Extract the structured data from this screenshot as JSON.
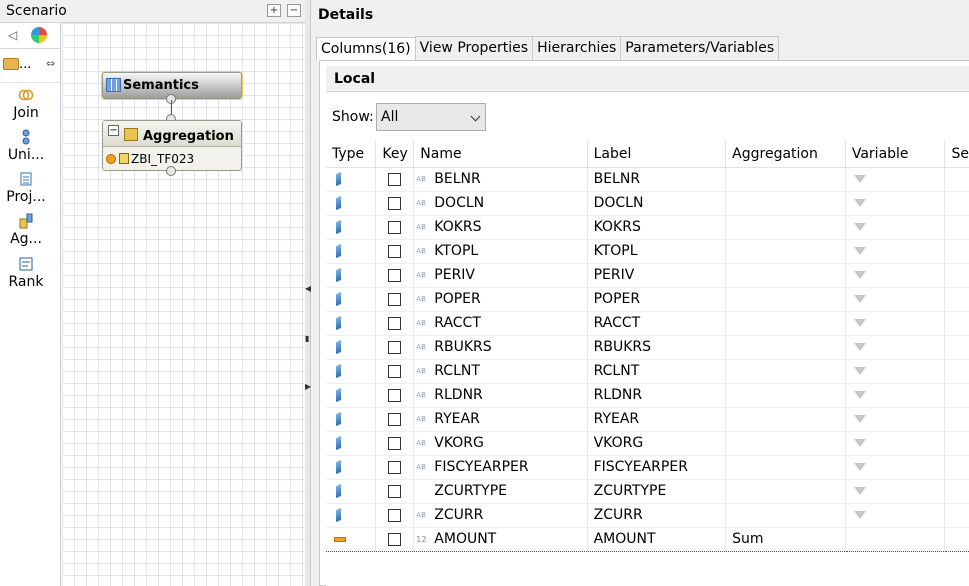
{
  "scenario": {
    "title": "Scenario",
    "palette_drawer_label": "...",
    "palette": [
      {
        "icon": "join-icon",
        "label": "Join"
      },
      {
        "icon": "union-icon",
        "label": "Uni..."
      },
      {
        "icon": "projection-icon",
        "label": "Proj..."
      },
      {
        "icon": "aggregation-icon",
        "label": "Ag..."
      },
      {
        "icon": "rank-icon",
        "label": "Rank"
      }
    ],
    "nodes": {
      "semantics": "Semantics",
      "aggregation": "Aggregation",
      "aggregation_source": "ZBI_TF023"
    }
  },
  "details": {
    "title": "Details",
    "tabs": [
      "Columns(16)",
      "View Properties",
      "Hierarchies",
      "Parameters/Variables"
    ],
    "active_tab": "Columns(16)",
    "section": "Local",
    "show_label": "Show:",
    "show_value": "All",
    "columns": [
      "Type",
      "Key",
      "Name",
      "Label",
      "Aggregation",
      "Variable",
      "Se"
    ],
    "rows": [
      {
        "type": "attribute",
        "dt": "AB",
        "name": "BELNR",
        "label": "BELNR",
        "aggregation": "",
        "variable": true
      },
      {
        "type": "attribute",
        "dt": "AB",
        "name": "DOCLN",
        "label": "DOCLN",
        "aggregation": "",
        "variable": true
      },
      {
        "type": "attribute",
        "dt": "AB",
        "name": "KOKRS",
        "label": "KOKRS",
        "aggregation": "",
        "variable": true
      },
      {
        "type": "attribute",
        "dt": "AB",
        "name": "KTOPL",
        "label": "KTOPL",
        "aggregation": "",
        "variable": true
      },
      {
        "type": "attribute",
        "dt": "AB",
        "name": "PERIV",
        "label": "PERIV",
        "aggregation": "",
        "variable": true
      },
      {
        "type": "attribute",
        "dt": "AB",
        "name": "POPER",
        "label": "POPER",
        "aggregation": "",
        "variable": true
      },
      {
        "type": "attribute",
        "dt": "AB",
        "name": "RACCT",
        "label": "RACCT",
        "aggregation": "",
        "variable": true
      },
      {
        "type": "attribute",
        "dt": "AB",
        "name": "RBUKRS",
        "label": "RBUKRS",
        "aggregation": "",
        "variable": true
      },
      {
        "type": "attribute",
        "dt": "AB",
        "name": "RCLNT",
        "label": "RCLNT",
        "aggregation": "",
        "variable": true
      },
      {
        "type": "attribute",
        "dt": "AB",
        "name": "RLDNR",
        "label": "RLDNR",
        "aggregation": "",
        "variable": true
      },
      {
        "type": "attribute",
        "dt": "AB",
        "name": "RYEAR",
        "label": "RYEAR",
        "aggregation": "",
        "variable": true
      },
      {
        "type": "attribute",
        "dt": "AB",
        "name": "VKORG",
        "label": "VKORG",
        "aggregation": "",
        "variable": true
      },
      {
        "type": "attribute",
        "dt": "AB",
        "name": "FISCYEARPER",
        "label": "FISCYEARPER",
        "aggregation": "",
        "variable": true
      },
      {
        "type": "attribute",
        "dt": "",
        "name": "ZCURTYPE",
        "label": "ZCURTYPE",
        "aggregation": "",
        "variable": true
      },
      {
        "type": "attribute",
        "dt": "AB",
        "name": "ZCURR",
        "label": "ZCURR",
        "aggregation": "",
        "variable": true
      },
      {
        "type": "measure",
        "dt": "12",
        "name": "AMOUNT",
        "label": "AMOUNT",
        "aggregation": "Sum",
        "variable": false
      }
    ]
  }
}
